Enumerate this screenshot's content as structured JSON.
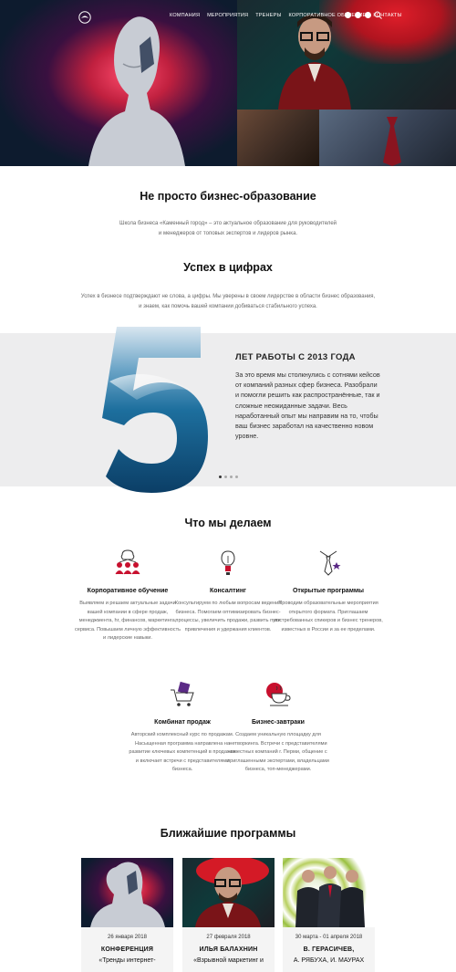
{
  "nav": {
    "links": [
      "Компания",
      "Мероприятия",
      "Тренеры",
      "Корпоративное обучение",
      "Контакты"
    ]
  },
  "intro": {
    "title": "Не просто бизнес-образование",
    "text_line1": "Школа бизнеса «Каменный город» – это актуальное образование для руководителей",
    "text_line2": "и менеджеров от топовых экспертов и лидеров рынка."
  },
  "success": {
    "title": "Успех в цифрах",
    "text_line1": "Успех в бизнесе подтверждают не слова, а цифры. Мы уверены в своем лидерстве в области бизнес образования,",
    "text_line2": "и знаем, как помочь вашей компании добиваться стабильного успеха."
  },
  "stat": {
    "number": "5",
    "heading": "ЛЕТ РАБОТЫ С 2013 ГОДА",
    "text": "За это время мы столкнулись с сотнями кейсов от компаний разных сфер бизнеса. Разобрали и помогли решить как распространённые, так и сложные неожиданные задачи. Весь наработанный опыт мы направим на то, чтобы ваш бизнес заработал на качественно новом уровне."
  },
  "services": {
    "title": "Что мы делаем",
    "items": [
      {
        "title": "Корпоративное обучение",
        "text": "Выявляем и решаем актуальные задачи вашей компании в сфере продаж, менеджмента, hr, финансов, маркетинга, сервиса. Повышаем личную эффективность и лидерские навыки."
      },
      {
        "title": "Консалтинг",
        "text": "Консультируем по любым вопросам ведения бизнеса. Помогаем оптимизировать бизнес-процессы, увеличить продажи, развить пути привлечения и удержания клиентов."
      },
      {
        "title": "Открытые программы",
        "text": "Проводим образовательные мероприятия открытого формата. Приглашаем востребованных спикеров и бизнес тренеров, известных в России и за ее пределами."
      },
      {
        "title": "Комбинат продаж",
        "text": "Авторский комплексный курс по продажам. Насыщенная программа направлена на развитие ключевых компетенций в продажах и включает встречи с представителями бизнеса."
      },
      {
        "title": "Бизнес-завтраки",
        "text": "Создаем уникальную площадку для нетворкинга. Встречи с представителями известных компаний г. Перми, общение с приглашенными экспертами, владельцами бизнеса, топ-менеджерами."
      }
    ]
  },
  "programs": {
    "title": "Ближайшие программы",
    "cards": [
      {
        "date": "26 января 2018",
        "title": "КОНФЕРЕНЦИЯ",
        "subtitle": "«Тренды интернет-"
      },
      {
        "date": "27 февраля 2018",
        "title": "ИЛЬЯ БАЛАХНИН",
        "subtitle": "«Взрывной маркетинг и"
      },
      {
        "date": "30 марта - 01 апреля 2018",
        "title": "В. ГЕРАСИЧЕВ,",
        "subtitle": "А. РЯБУХА, И. МАУРАХ"
      }
    ]
  },
  "colors": {
    "accent": "#c8102e",
    "purple": "#5b2a86",
    "band": "#ededee"
  }
}
